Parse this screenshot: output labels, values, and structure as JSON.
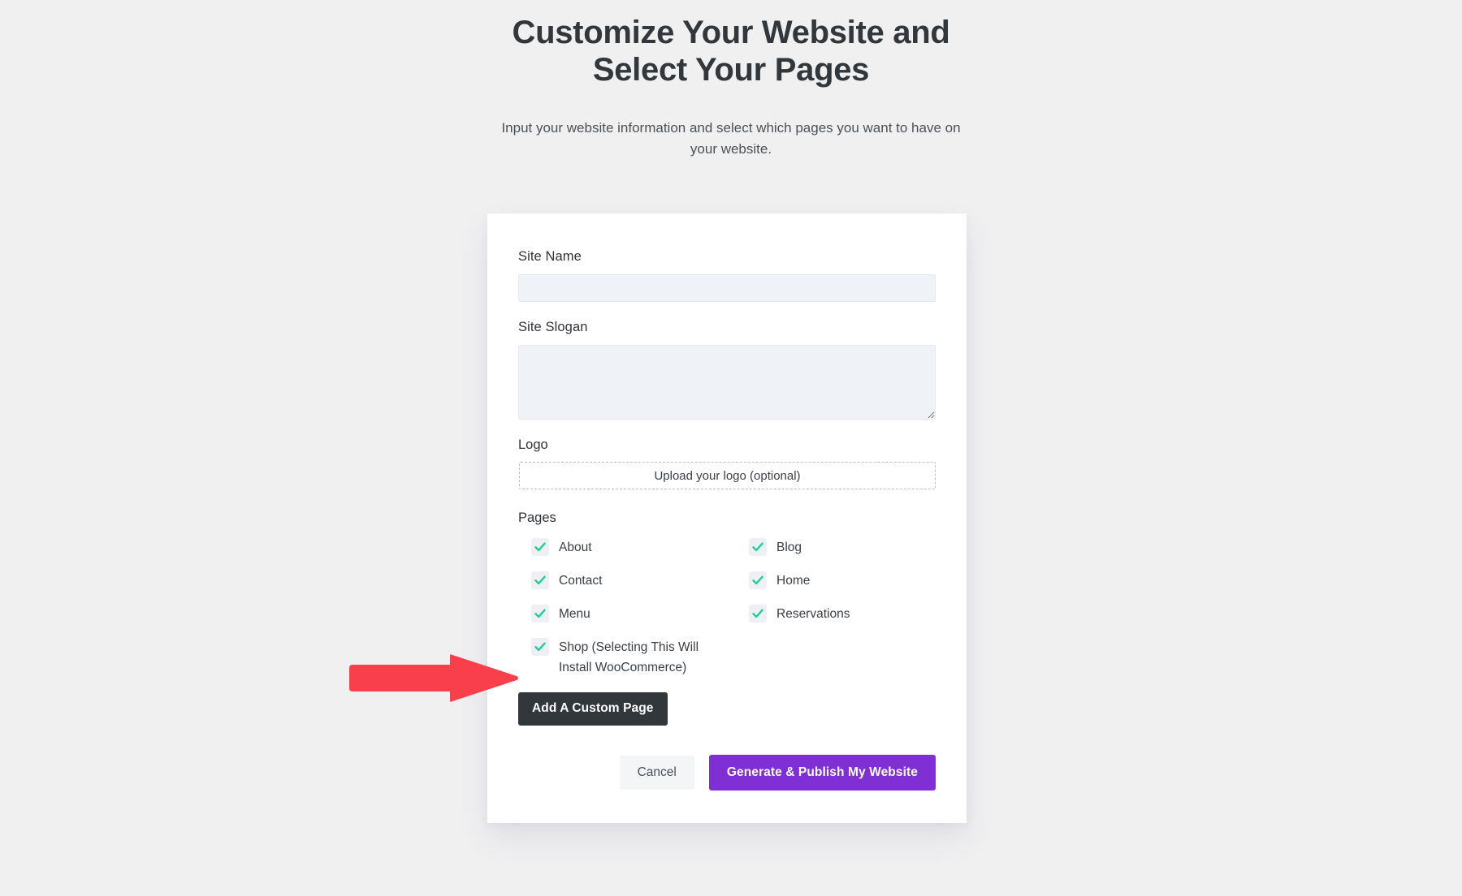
{
  "header": {
    "title": "Customize Your Website and Select Your Pages",
    "subtitle": "Input your website information and select which pages you want to have on your website."
  },
  "form": {
    "site_name": {
      "label": "Site Name",
      "value": "",
      "placeholder": ""
    },
    "site_slogan": {
      "label": "Site Slogan",
      "value": "",
      "placeholder": ""
    },
    "logo": {
      "label": "Logo",
      "upload_text": "Upload your logo (optional)"
    },
    "pages": {
      "label": "Pages",
      "options": [
        {
          "label": "About",
          "checked": true
        },
        {
          "label": "Blog",
          "checked": true
        },
        {
          "label": "Contact",
          "checked": true
        },
        {
          "label": "Home",
          "checked": true
        },
        {
          "label": "Menu",
          "checked": true
        },
        {
          "label": "Reservations",
          "checked": true
        },
        {
          "label": "Shop (Selecting This Will Install WooCommerce)",
          "checked": true
        }
      ]
    },
    "add_custom_page_label": "Add A Custom Page"
  },
  "actions": {
    "cancel_label": "Cancel",
    "publish_label": "Generate & Publish My Website"
  },
  "annotation": {
    "type": "arrow-right",
    "points_to": "Shop (Selecting This Will Install WooCommerce)",
    "color": "#f93f4c"
  },
  "colors": {
    "background": "#f0f0f1",
    "card": "#ffffff",
    "input_fill": "#eff2f6",
    "checkbox_fill": "#eef0f5",
    "check_green": "#14d18e",
    "dark_button": "#32373c",
    "primary_purple": "#7f2fd4",
    "cancel_button": "#f4f5f7",
    "annotation_red": "#f93f4c"
  }
}
